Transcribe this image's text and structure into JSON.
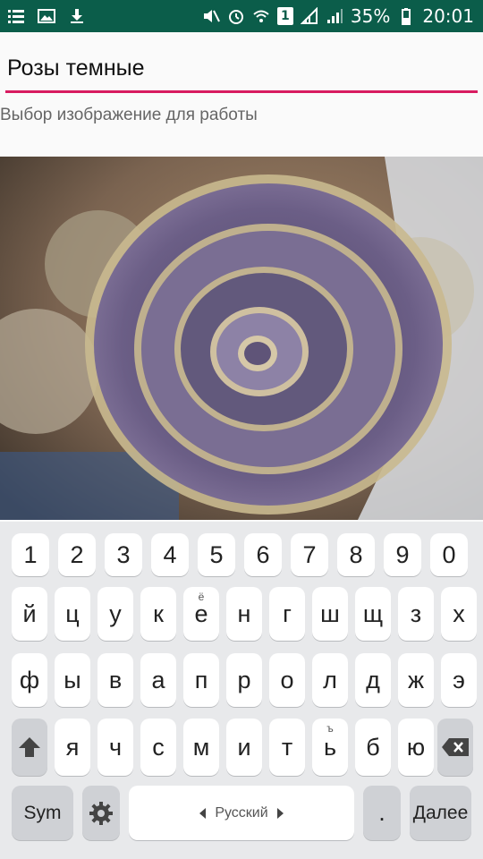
{
  "status_bar": {
    "battery": "35%",
    "time": "20:01",
    "sim": "1",
    "left_icons": [
      "notification-list-icon",
      "gallery-icon",
      "download-icon"
    ],
    "right_icons": [
      "mute-icon",
      "alarm-icon",
      "wifi-icon",
      "sim-icon",
      "signal-icon",
      "signal-icon",
      "battery-icon"
    ]
  },
  "form": {
    "title_value": "Розы темные",
    "subtitle": "Выбор изображение для работы"
  },
  "photo": {
    "icon": "beaded-rose-image"
  },
  "keyboard": {
    "row_numbers": [
      "1",
      "2",
      "3",
      "4",
      "5",
      "6",
      "7",
      "8",
      "9",
      "0"
    ],
    "row1": [
      "й",
      "ц",
      "у",
      "к",
      "е",
      "н",
      "г",
      "ш",
      "щ",
      "з",
      "х"
    ],
    "row1_hint_e": "ё",
    "row2": [
      "ф",
      "ы",
      "в",
      "а",
      "п",
      "р",
      "о",
      "л",
      "д",
      "ж",
      "э"
    ],
    "row3": [
      "я",
      "ч",
      "с",
      "м",
      "и",
      "т",
      "ь",
      "б",
      "ю"
    ],
    "row3_hint_soft": "ъ",
    "sym": "Sym",
    "space": "Русский",
    "period": ".",
    "done": "Далее"
  },
  "colors": {
    "status_bar": "#0b5d4a",
    "accent": "#d81b60",
    "keyboard_bg": "#e8e9eb"
  }
}
